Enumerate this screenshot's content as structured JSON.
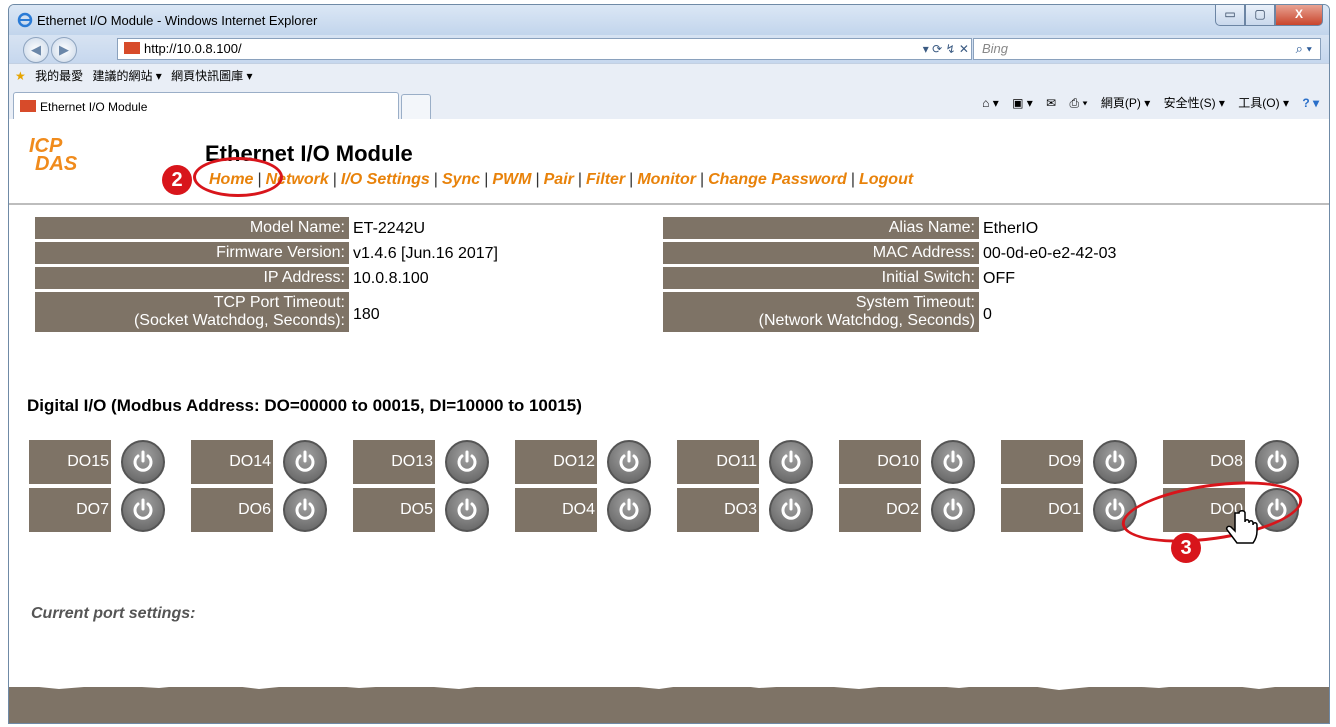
{
  "window": {
    "title": "Ethernet I/O Module - Windows Internet Explorer",
    "btn_min": "▭",
    "btn_max": "▢",
    "btn_close": "X"
  },
  "address": {
    "url": "http://10.0.8.100/",
    "tools": "▾ ⟳ ↯ ✕",
    "search_placeholder": "Bing",
    "search_icon": "⌕ ▾"
  },
  "favorites": {
    "fav_label": "我的最愛",
    "suggested": "建議的網站 ▾",
    "webslice": "網頁快訊圖庫 ▾"
  },
  "tab": {
    "title": "Ethernet I/O Module"
  },
  "commandbar": {
    "home": "⌂ ▾",
    "feeds": "▣ ▾",
    "mail": "✉",
    "print": "⎙ ▾",
    "page": "網頁(P) ▾",
    "safety": "安全性(S) ▾",
    "tools": "工具(O) ▾",
    "help": "? ▾"
  },
  "header": {
    "logo_line1": "ICP",
    "logo_line2": "DAS",
    "title": "Ethernet I/O Module",
    "nav": [
      "Home",
      "Network",
      "I/O Settings",
      "Sync",
      "PWM",
      "Pair",
      "Filter",
      "Monitor",
      "Change Password",
      "Logout"
    ],
    "nav_sep": "|"
  },
  "info_left": [
    {
      "label": "Model Name:",
      "value": "ET-2242U"
    },
    {
      "label": "Firmware Version:",
      "value": "v1.4.6 [Jun.16 2017]"
    },
    {
      "label": "IP Address:",
      "value": "10.0.8.100"
    },
    {
      "label": "TCP Port Timeout:",
      "label2": "(Socket Watchdog, Seconds):",
      "value": "180"
    }
  ],
  "info_right": [
    {
      "label": "Alias Name:",
      "value": "EtherIO"
    },
    {
      "label": "MAC Address:",
      "value": "00-0d-e0-e2-42-03"
    },
    {
      "label": "Initial Switch:",
      "value": "OFF"
    },
    {
      "label": "System Timeout:",
      "label2": "(Network Watchdog, Seconds)",
      "value": "0"
    }
  ],
  "dio_title": "Digital I/O (Modbus Address: DO=00000 to 00015, DI=10000 to 10015)",
  "do_row1": [
    "DO15",
    "DO14",
    "DO13",
    "DO12",
    "DO11",
    "DO10",
    "DO9",
    "DO8"
  ],
  "do_row2": [
    "DO7",
    "DO6",
    "DO5",
    "DO4",
    "DO3",
    "DO2",
    "DO1",
    "DO0"
  ],
  "current_port_settings": "Current port settings:",
  "callouts": {
    "c2": "2",
    "c3": "3"
  },
  "colors": {
    "label_bg": "#7e7366",
    "nav": "#e8820a",
    "callout": "#d8151b"
  }
}
